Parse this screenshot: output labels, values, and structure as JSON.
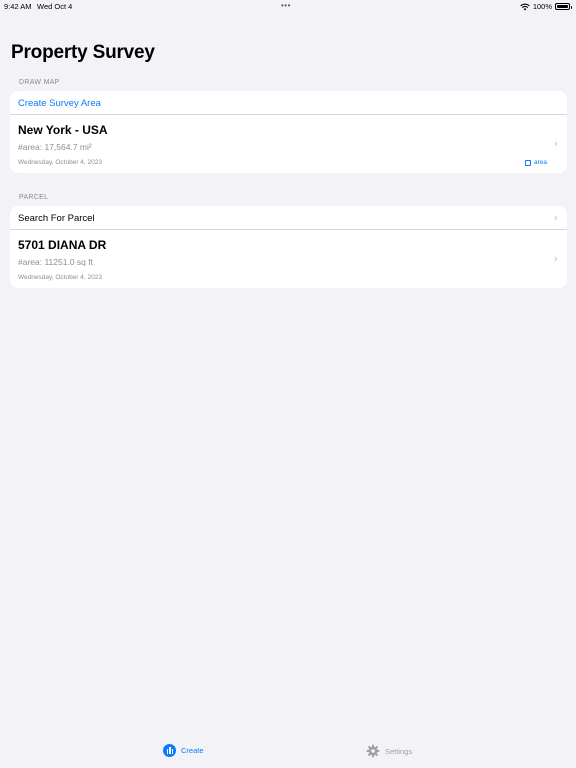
{
  "status_bar": {
    "time": "9:42 AM",
    "date": "Wed Oct 4",
    "dots": "•••",
    "battery": "100%",
    "battery_level": 1.0
  },
  "page": {
    "title": "Property Survey"
  },
  "draw_map": {
    "header": "DRAW MAP",
    "create_label": "Create Survey Area",
    "item": {
      "title": "New York - USA",
      "subtitle": "#area: 17,564.7 mi²",
      "date": "Wednesday, October 4, 2023",
      "tag": "area"
    }
  },
  "parcel": {
    "header": "PARCEL",
    "search_label": "Search For Parcel",
    "item": {
      "title": "5701 DIANA DR",
      "subtitle": "#area: 11251.0 sq ft",
      "date": "Wednesday, October 4, 2023"
    }
  },
  "tab_bar": {
    "tabs": [
      {
        "label": "Create",
        "icon": "chart-icon",
        "selected": true
      },
      {
        "label": "Settings",
        "icon": "gear-icon",
        "selected": false
      }
    ]
  },
  "colors": {
    "accent": "#0a7aff",
    "background": "#f2f2f7",
    "secondary_text": "#8e8e93"
  }
}
